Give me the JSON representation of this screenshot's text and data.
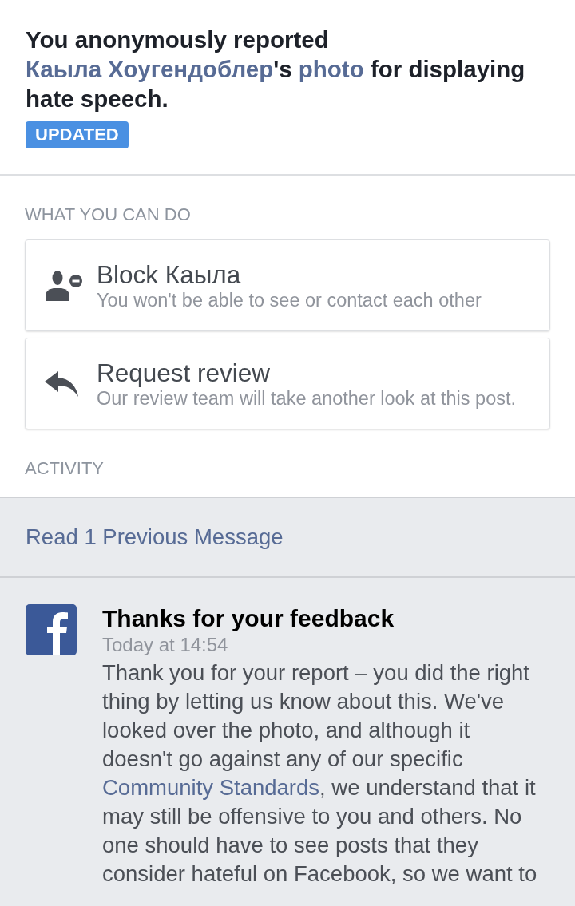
{
  "report": {
    "headline": [
      {
        "kind": "text",
        "text": "You anonymously reported "
      },
      {
        "kind": "link",
        "text": "Каыла Хоугендоблер"
      },
      {
        "kind": "text",
        "text": "'s "
      },
      {
        "kind": "link",
        "text": "photo"
      },
      {
        "kind": "text",
        "text": " for displaying hate speech."
      }
    ],
    "badge": "UPDATED"
  },
  "actions_section": {
    "heading": "WHAT YOU CAN DO",
    "actions": [
      {
        "kind": "block",
        "title": "Block Каыла",
        "subtitle": "You won't be able to see or contact each other"
      },
      {
        "kind": "review",
        "title": "Request review",
        "subtitle": "Our review team will take another look at this post."
      }
    ]
  },
  "activity": {
    "heading": "ACTIVITY",
    "previous_link": "Read 1 Previous Message",
    "message": {
      "title": "Thanks for your feedback",
      "time": "Today at 14:54",
      "body": [
        {
          "kind": "text",
          "text": "Thank you for your report – you did the right thing by letting us know about this. We've looked over the photo, and although it doesn't go against any of our specific "
        },
        {
          "kind": "link",
          "text": "Community Standards"
        },
        {
          "kind": "text",
          "text": ", we understand that it may still be offensive to you and others. No one should have to see posts that they consider hateful on Facebook, so we want to"
        }
      ]
    }
  }
}
